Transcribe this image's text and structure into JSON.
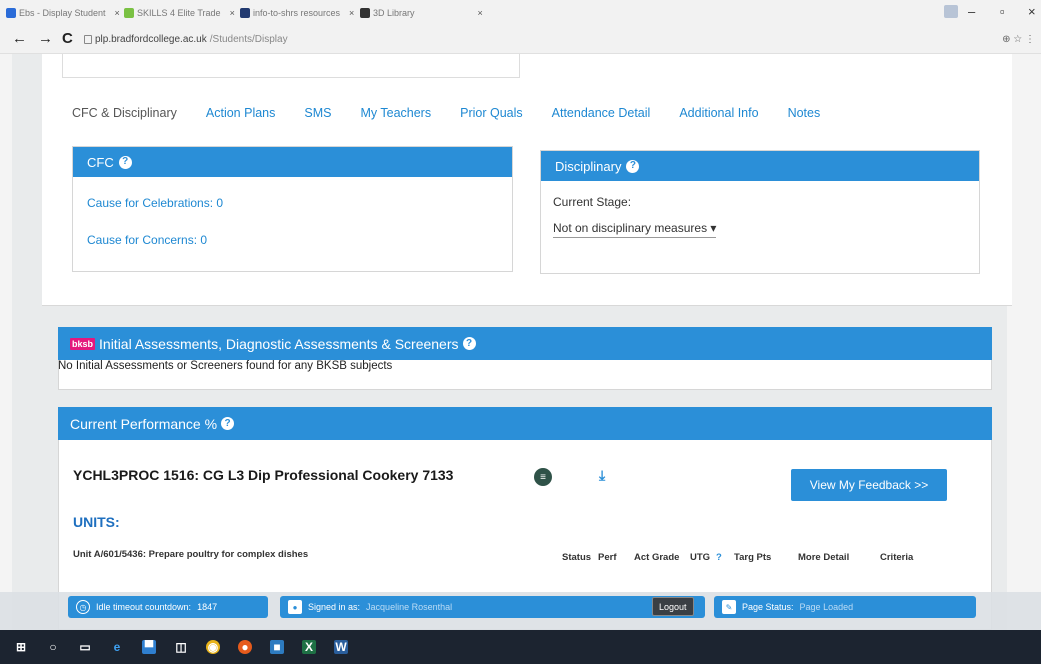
{
  "browser": {
    "tabs": [
      {
        "label": "Ebs - Display Student"
      },
      {
        "label": "SKILLS 4 Elite Trade"
      },
      {
        "label": "info-to-shrs resources"
      },
      {
        "label": "3D Library"
      }
    ],
    "url_host": "plp.bradfordcollege.ac.uk",
    "url_path": "/Students/Display"
  },
  "tabs": [
    {
      "label": "CFC & Disciplinary"
    },
    {
      "label": "Action Plans"
    },
    {
      "label": "SMS"
    },
    {
      "label": "My Teachers"
    },
    {
      "label": "Prior Quals"
    },
    {
      "label": "Attendance Detail"
    },
    {
      "label": "Additional Info"
    },
    {
      "label": "Notes"
    }
  ],
  "cfc": {
    "title": "CFC",
    "celebrations": "Cause for Celebrations: 0",
    "concerns": "Cause for Concerns: 0"
  },
  "disciplinary": {
    "title": "Disciplinary",
    "stage_label": "Current Stage:",
    "stage_value": "Not on disciplinary measures"
  },
  "assessments": {
    "logo": "bksb",
    "title": "Initial Assessments, Diagnostic Assessments & Screeners",
    "empty_message": "No Initial Assessments or Screeners found for any BKSB subjects"
  },
  "performance": {
    "title": "Current Performance %",
    "course": "YCHL3PROC 1516: CG L3 Dip Professional Cookery 7133",
    "feedback_button": "View My Feedback >>",
    "units_heading": "UNITS:",
    "unit_name": "Unit A/601/5436: Prepare poultry for complex dishes",
    "columns": {
      "status": "Status",
      "perf": "Perf",
      "act_grade": "Act Grade",
      "utg": "UTG",
      "utg_help": "?",
      "targ_pts": "Targ Pts",
      "more_detail": "More Detail",
      "criteria": "Criteria"
    }
  },
  "statusbar": {
    "idle_label": "Idle timeout countdown:",
    "idle_value": "1847",
    "signed_label": "Signed in as:",
    "signed_user": "Jacqueline Rosenthal",
    "logout": "Logout",
    "page_status_label": "Page Status:",
    "page_status_value": "Page Loaded"
  },
  "colors": {
    "accent": "#2b8fd8",
    "link": "#1e88d2",
    "bksb": "#e4177d"
  }
}
